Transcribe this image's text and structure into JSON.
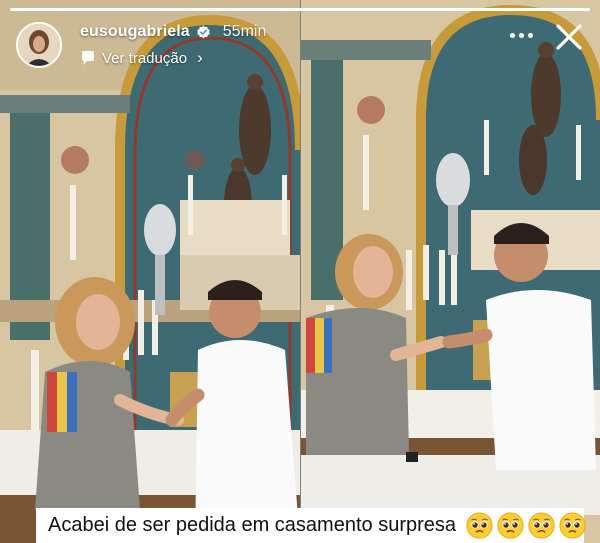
{
  "story": {
    "progress": 1.0,
    "username": "eusougabriela",
    "verified": true,
    "time": "55min",
    "translate_label": "Ver tradução",
    "more_icon": "more-horizontal-icon",
    "close_icon": "close-icon",
    "caption": "Acabei de ser pedida em casamento surpresa",
    "caption_emoji": "pleading-face-emoji",
    "caption_emoji_count": 4
  }
}
